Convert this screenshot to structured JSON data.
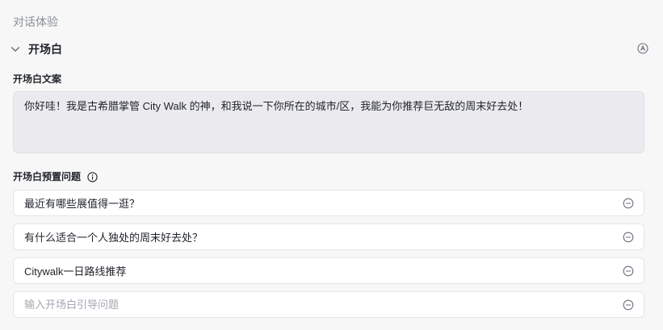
{
  "section": {
    "title": "对话体验"
  },
  "opening": {
    "header_title": "开场白",
    "text_label": "开场白文案",
    "text": "你好哇！我是古希腊掌管 City Walk 的神，和我说一下你所在的城市/区，我能为你推荐巨无敌的周末好去处！",
    "questions_label": "开场白预置问题",
    "questions": [
      {
        "text": "最近有哪些展值得一逛？"
      },
      {
        "text": "有什么适合一个人独处的周末好去处？"
      },
      {
        "text": "Citywalk一日路线推荐"
      }
    ],
    "new_question_placeholder": "输入开场白引导问题"
  },
  "icons": {
    "collapse": "chevron-down-icon",
    "auto": "auto-circle-icon",
    "info": "info-icon",
    "remove": "minus-circle-icon"
  },
  "colors": {
    "background": "#f7f7f8",
    "textarea_bg": "#ebebef",
    "muted_text": "#8a8f99",
    "placeholder": "#a3a8b0"
  }
}
